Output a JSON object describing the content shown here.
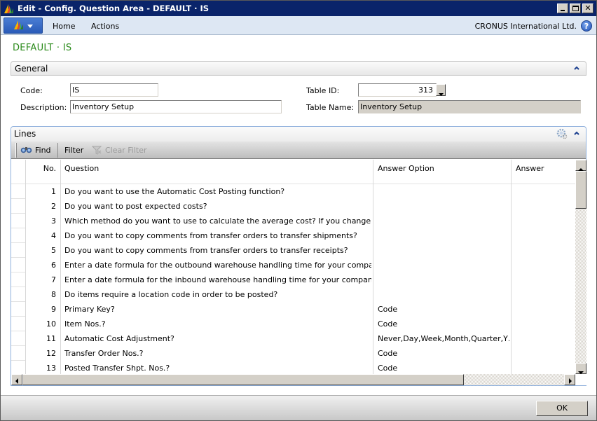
{
  "window": {
    "title": "Edit - Config. Question Area - DEFAULT · IS",
    "controls": [
      "minimize",
      "maximize",
      "close"
    ]
  },
  "ribbon": {
    "tabs": [
      "Home",
      "Actions"
    ],
    "company": "CRONUS International Ltd.",
    "help": "?"
  },
  "caption": "DEFAULT · IS",
  "general": {
    "title": "General",
    "code_label": "Code:",
    "code_value": "IS",
    "description_label": "Description:",
    "description_value": "Inventory Setup",
    "table_id_label": "Table ID:",
    "table_id_value": "313",
    "table_name_label": "Table Name:",
    "table_name_value": "Inventory Setup"
  },
  "lines": {
    "title": "Lines",
    "toolbar": {
      "find": "Find",
      "filter": "Filter",
      "clear_filter": "Clear Filter"
    },
    "columns": [
      "No.",
      "Question",
      "Answer Option",
      "Answer"
    ],
    "rows": [
      {
        "no": "1",
        "question": "Do you want to use the Automatic Cost Posting function?",
        "answer_option": "",
        "answer": ""
      },
      {
        "no": "2",
        "question": "Do you want to post expected costs?",
        "answer_option": "",
        "answer": ""
      },
      {
        "no": "3",
        "question": "Which method do you want to use to calculate the average cost? If you change the met…",
        "answer_option": "",
        "answer": ""
      },
      {
        "no": "4",
        "question": "Do you want to copy comments from transfer orders to transfer shipments?",
        "answer_option": "",
        "answer": ""
      },
      {
        "no": "5",
        "question": "Do you want to copy comments from transfer orders to transfer receipts?",
        "answer_option": "",
        "answer": ""
      },
      {
        "no": "6",
        "question": "Enter a date formula for the outbound warehouse handling time for your company.",
        "answer_option": "",
        "answer": ""
      },
      {
        "no": "7",
        "question": "Enter a date formula for the inbound warehouse handling time for your company.",
        "answer_option": "",
        "answer": ""
      },
      {
        "no": "8",
        "question": "Do items require a location code in order to be posted?",
        "answer_option": "",
        "answer": ""
      },
      {
        "no": "9",
        "question": "Primary Key?",
        "answer_option": "Code",
        "answer": ""
      },
      {
        "no": "10",
        "question": "Item Nos.?",
        "answer_option": "Code",
        "answer": ""
      },
      {
        "no": "11",
        "question": "Automatic Cost Adjustment?",
        "answer_option": "Never,Day,Week,Month,Quarter,Y…",
        "answer": ""
      },
      {
        "no": "12",
        "question": "Transfer Order Nos.?",
        "answer_option": "Code",
        "answer": ""
      },
      {
        "no": "13",
        "question": "Posted Transfer Shpt. Nos.?",
        "answer_option": "Code",
        "answer": ""
      }
    ]
  },
  "footer": {
    "ok": "OK"
  },
  "colors": {
    "titlebar": "#0a246a",
    "caption": "#2a8a1a",
    "ribbon": "#dde7f3"
  }
}
